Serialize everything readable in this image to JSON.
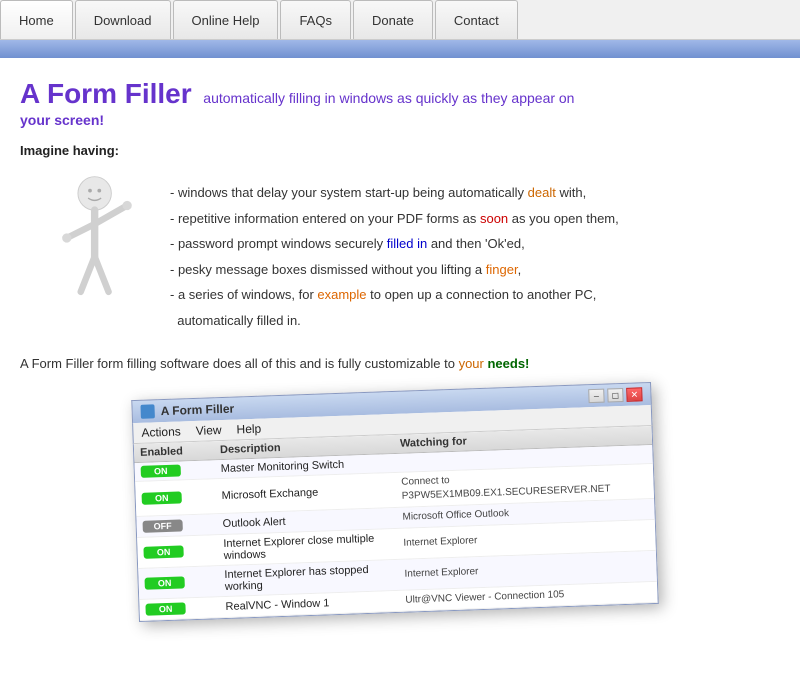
{
  "nav": {
    "tabs": [
      {
        "label": "Home",
        "id": "home"
      },
      {
        "label": "Download",
        "id": "download"
      },
      {
        "label": "Online Help",
        "id": "online-help"
      },
      {
        "label": "FAQs",
        "id": "faqs"
      },
      {
        "label": "Donate",
        "id": "donate"
      },
      {
        "label": "Contact",
        "id": "contact"
      }
    ]
  },
  "hero": {
    "title_big": "A Form Filler",
    "title_sub": "automatically filling in windows as quickly as they appear on",
    "title_line2": "your screen!",
    "imagine_label": "Imagine having:",
    "bullets": [
      {
        "text": "- windows that delay your system start-up being automatically dealt with,",
        "highlight_word": "dealt",
        "highlight_color": "orange"
      },
      {
        "text": "- repetitive information entered on your PDF forms as soon as you open them,",
        "highlight_word": "soon",
        "highlight_color": "red"
      },
      {
        "text": "- password prompt windows securely filled in and then 'Ok'ed,",
        "highlight_word": "filled",
        "highlight_color": "blue"
      },
      {
        "text": "- pesky message boxes dismissed without you lifting a finger,",
        "highlight_word": "finger",
        "highlight_color": "orange"
      },
      {
        "text": "- a series of windows, for example to open up a connection to another PC,",
        "highlight_word": "example",
        "highlight_color": "orange"
      },
      {
        "text": "  automatically filled in.",
        "highlight_word": "",
        "highlight_color": ""
      }
    ],
    "bottom_text_1": "A Form Filler form filling software does all of this and is fully customizable to your needs!"
  },
  "window": {
    "title": "A Form Filler",
    "menus": [
      "Actions",
      "View",
      "Help"
    ],
    "table": {
      "headers": [
        "Enabled",
        "Description",
        "Watching for"
      ],
      "rows": [
        {
          "enabled": "ON",
          "enabled_state": "on",
          "description": "Master Monitoring Switch",
          "watching": ""
        },
        {
          "enabled": "ON",
          "enabled_state": "on",
          "description": "Microsoft Exchange",
          "watching": "Connect to P3PW5EX1MB09.EX1.SECURESERVER.NET"
        },
        {
          "enabled": "OFF",
          "enabled_state": "off",
          "description": "Outlook Alert",
          "watching": "Microsoft Office Outlook"
        },
        {
          "enabled": "ON",
          "enabled_state": "on",
          "description": "Internet Explorer close multiple windows",
          "watching": "Internet Explorer"
        },
        {
          "enabled": "ON",
          "enabled_state": "on",
          "description": "Internet Explorer has stopped working",
          "watching": "Internet Explorer"
        },
        {
          "enabled": "ON",
          "enabled_state": "on",
          "description": "RealVNC - Window 1",
          "watching": "Ultr@VNC Viewer - Connection 105"
        }
      ]
    }
  },
  "labels": {
    "on": "ON",
    "off": "OFF"
  }
}
